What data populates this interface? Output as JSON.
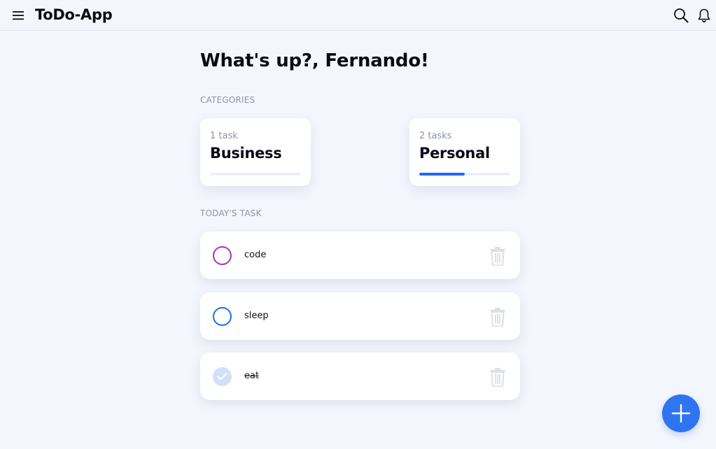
{
  "app": {
    "title": "ToDo-App"
  },
  "header": {
    "icons": [
      "hamburger-menu-icon",
      "search-icon",
      "bell-icon"
    ]
  },
  "greeting": "What's up?, Fernando!",
  "categories": {
    "label": "CATEGORIES",
    "items": [
      {
        "count": "1 task",
        "name": "Business",
        "progress": 0
      },
      {
        "count": "2 tasks",
        "name": "Personal",
        "progress": 0.5
      }
    ]
  },
  "tasks": {
    "label": "TODAY'S TASK",
    "items": [
      {
        "text": "code",
        "done": false,
        "color": "#a434b8"
      },
      {
        "text": "sleep",
        "done": false,
        "color": "#1b6cf2"
      },
      {
        "text": "eat",
        "done": true,
        "color": "#cfe0fb"
      }
    ]
  },
  "colors": {
    "background": "#f4f6fd",
    "accent": "#2f74f0",
    "progress": "#1b6cf2"
  }
}
